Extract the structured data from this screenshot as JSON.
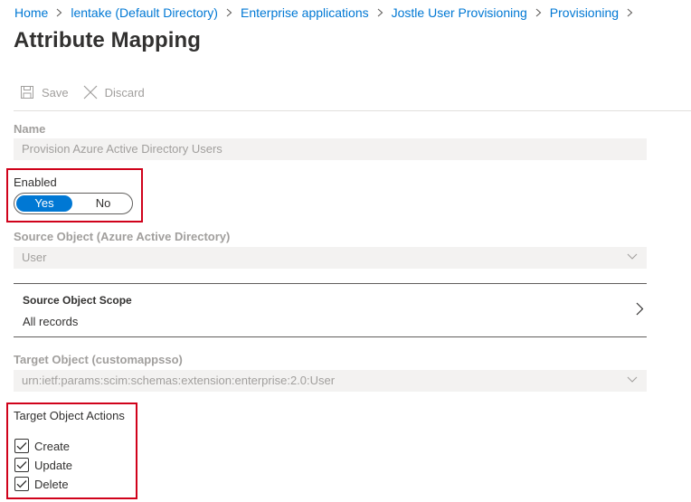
{
  "breadcrumb": [
    {
      "label": "Home"
    },
    {
      "label": "lentake (Default Directory)"
    },
    {
      "label": "Enterprise applications"
    },
    {
      "label": "Jostle User Provisioning"
    },
    {
      "label": "Provisioning"
    }
  ],
  "page": {
    "title": "Attribute Mapping"
  },
  "toolbar": {
    "save_label": "Save",
    "discard_label": "Discard"
  },
  "form": {
    "name_label": "Name",
    "name_value": "Provision Azure Active Directory Users",
    "enabled_label": "Enabled",
    "enabled_yes": "Yes",
    "enabled_no": "No",
    "enabled_selected": "Yes",
    "source_object_label": "Source Object (Azure Active Directory)",
    "source_object_value": "User",
    "source_scope_title": "Source Object Scope",
    "source_scope_value": "All records",
    "target_object_label": "Target Object (customappsso)",
    "target_object_value": "urn:ietf:params:scim:schemas:extension:enterprise:2.0:User",
    "target_actions_label": "Target Object Actions",
    "actions": [
      {
        "label": "Create",
        "checked": true
      },
      {
        "label": "Update",
        "checked": true
      },
      {
        "label": "Delete",
        "checked": true
      }
    ]
  },
  "colors": {
    "accent": "#0078d4",
    "highlight": "#d0021b"
  }
}
